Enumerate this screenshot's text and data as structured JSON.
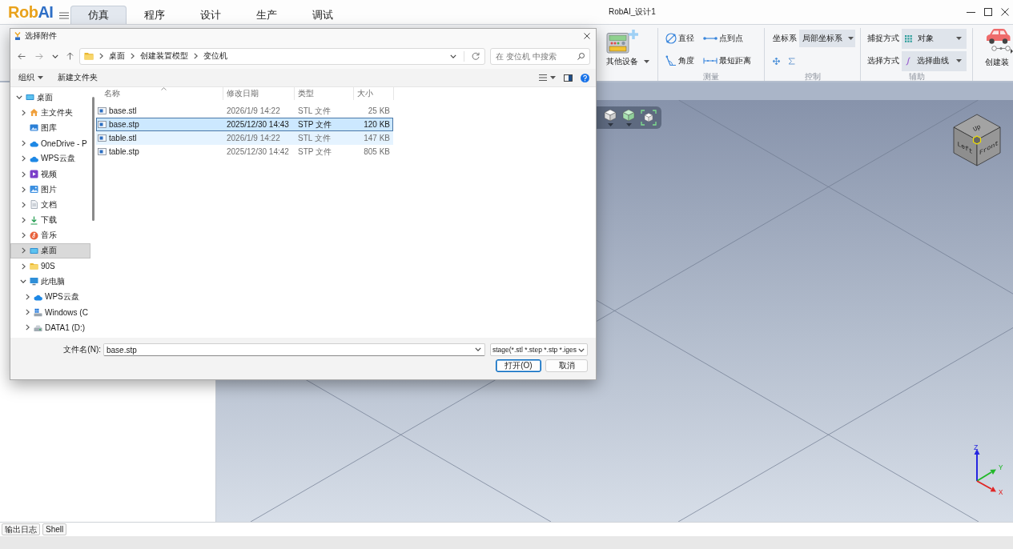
{
  "app": {
    "logo": [
      {
        "text": "Rob",
        "color": "#e9a21c"
      },
      {
        "text": "AI",
        "color": "#2f6fc6"
      }
    ],
    "tabs": [
      {
        "label": "仿真",
        "selected": true
      },
      {
        "label": "程序",
        "selected": false
      },
      {
        "label": "设计",
        "selected": false
      },
      {
        "label": "生产",
        "selected": false
      },
      {
        "label": "调试",
        "selected": false
      }
    ],
    "title": "RobAI_设计1"
  },
  "ribbon": {
    "other_devices": {
      "label": "其他设备"
    },
    "measure": {
      "title": "测量",
      "tools": [
        {
          "kind": "diameter",
          "label": "直径"
        },
        {
          "kind": "point-to-point",
          "label": "点到点"
        },
        {
          "kind": "angle",
          "label": "角度"
        },
        {
          "kind": "min-distance",
          "label": "最短距离"
        }
      ]
    },
    "control": {
      "title": "控制",
      "coordinate_label": "坐标系",
      "coordinate_value": "局部坐标系"
    },
    "assist": {
      "title": "辅助",
      "rows": [
        {
          "kind": "snap",
          "label": "捕捉方式",
          "value": "对象"
        },
        {
          "kind": "select",
          "label": "选择方式",
          "value": "选择曲线"
        }
      ]
    },
    "create": {
      "label": "创建装"
    }
  },
  "viewport": {
    "view_cube": {
      "top": "Up",
      "left": "Left",
      "front": "Front"
    },
    "axes": [
      {
        "label": "Z",
        "color": "#2626e0"
      },
      {
        "label": "Y",
        "color": "#22b82a"
      },
      {
        "label": "X",
        "color": "#e02626"
      }
    ]
  },
  "bottom_tabs": [
    {
      "label": "输出日志"
    },
    {
      "label": "Shell"
    }
  ],
  "dialog": {
    "title": "选择附件",
    "breadcrumb": [
      "桌面",
      "创建装置模型",
      "变位机"
    ],
    "search": {
      "placeholder": "在 变位机 中搜索"
    },
    "organize": "组织",
    "new_folder": "新建文件夹",
    "nav_tree": [
      {
        "kind": "desktop",
        "label": "桌面",
        "expanded": true,
        "selected": false,
        "children": [
          {
            "kind": "home",
            "label": "主文件夹",
            "expanded": false,
            "selected": false
          },
          {
            "kind": "gallery",
            "label": "图库",
            "selected": false
          },
          {
            "kind": "cloud",
            "label": "OneDrive - P",
            "expanded": false,
            "selected": false
          },
          {
            "kind": "cloud",
            "label": "WPS云盘",
            "expanded": false,
            "selected": false
          },
          {
            "kind": "video",
            "label": "视频",
            "expanded": false,
            "selected": false
          },
          {
            "kind": "pictures",
            "label": "图片",
            "expanded": false,
            "selected": false
          },
          {
            "kind": "documents",
            "label": "文档",
            "expanded": false,
            "selected": false
          },
          {
            "kind": "downloads",
            "label": "下载",
            "expanded": false,
            "selected": false
          },
          {
            "kind": "music",
            "label": "音乐",
            "expanded": false,
            "selected": false
          },
          {
            "kind": "desktop",
            "label": "桌面",
            "expanded": false,
            "selected": true
          },
          {
            "kind": "folder",
            "label": "90S",
            "expanded": false,
            "selected": false
          },
          {
            "kind": "pc",
            "label": "此电脑",
            "expanded": true,
            "selected": false,
            "children": [
              {
                "kind": "cloud",
                "label": "WPS云盘",
                "expanded": false,
                "selected": false
              },
              {
                "kind": "system-drive",
                "label": "Windows (C",
                "expanded": false,
                "selected": false
              },
              {
                "kind": "drive",
                "label": "DATA1 (D:)",
                "expanded": false,
                "selected": false
              }
            ]
          }
        ]
      }
    ],
    "columns": [
      {
        "label": "名称",
        "sorted": true
      },
      {
        "label": "修改日期",
        "sorted": false
      },
      {
        "label": "类型",
        "sorted": false
      },
      {
        "label": "大小",
        "sorted": false
      }
    ],
    "files": [
      {
        "name": "base.stl",
        "modified": "2026/1/9 14:22",
        "type": "STL 文件",
        "size": "25 KB",
        "selected": false,
        "hovered": false
      },
      {
        "name": "base.stp",
        "modified": "2025/12/30 14:43",
        "type": "STP 文件",
        "size": "120 KB",
        "selected": true,
        "hovered": false
      },
      {
        "name": "table.stl",
        "modified": "2026/1/9 14:22",
        "type": "STL 文件",
        "size": "147 KB",
        "selected": false,
        "hovered": true
      },
      {
        "name": "table.stp",
        "modified": "2025/12/30 14:42",
        "type": "STP 文件",
        "size": "805 KB",
        "selected": false,
        "hovered": false
      }
    ],
    "filename_label": "文件名(N):",
    "filename": "base.stp",
    "file_type": "stage(*.stl *.step *.stp *.iges",
    "buttons": [
      {
        "label": "打开(O)",
        "default": true
      },
      {
        "label": "取消",
        "default": false
      }
    ]
  }
}
